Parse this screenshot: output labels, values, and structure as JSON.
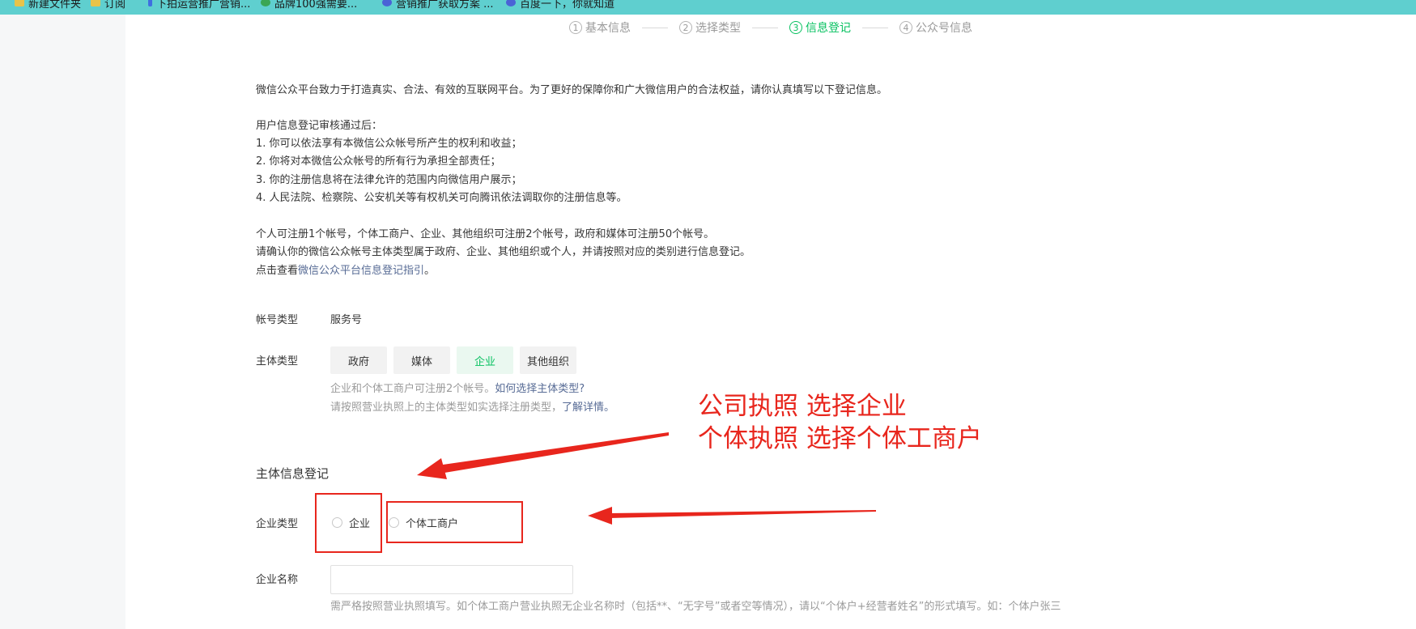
{
  "bookmarks": [
    {
      "label": "新建文件夹",
      "icon": "folder-icon"
    },
    {
      "label": "订阅",
      "icon": "folder-icon"
    },
    {
      "label": "下拍运营推广营销...",
      "icon": "bookmark-icon"
    },
    {
      "label": "品牌100强需要...",
      "icon": "site-icon"
    },
    {
      "label": "营销推广获取方案 ...",
      "icon": "baidu-icon"
    },
    {
      "label": "百度一下，你就知道",
      "icon": "baidu-icon"
    }
  ],
  "steps": [
    {
      "num": "1",
      "label": "基本信息"
    },
    {
      "num": "2",
      "label": "选择类型"
    },
    {
      "num": "3",
      "label": "信息登记"
    },
    {
      "num": "4",
      "label": "公众号信息"
    }
  ],
  "intro": "微信公众平台致力于打造真实、合法、有效的互联网平台。为了更好的保障你和广大微信用户的合法权益，请你认真填写以下登记信息。",
  "after_title": "用户信息登记审核通过后：",
  "after_items": [
    "1. 你可以依法享有本微信公众帐号所产生的权利和收益；",
    "2. 你将对本微信公众帐号的所有行为承担全部责任；",
    "3. 你的注册信息将在法律允许的范围内向微信用户展示；",
    "4. 人民法院、检察院、公安机关等有权机关可向腾讯依法调取你的注册信息等。"
  ],
  "rules": [
    "个人可注册1个帐号，个体工商户、企业、其他组织可注册2个帐号，政府和媒体可注册50个帐号。",
    "请确认你的微信公众帐号主体类型属于政府、企业、其他组织或个人，并请按照对应的类别进行信息登记。"
  ],
  "guide": {
    "prefix": "点击查看",
    "link": "微信公众平台信息登记指引",
    "suffix": "。"
  },
  "account_type": {
    "label": "帐号类型",
    "value": "服务号"
  },
  "subject_type": {
    "label": "主体类型",
    "options": [
      "政府",
      "媒体",
      "企业",
      "其他组织"
    ],
    "selected": "企业",
    "hint1": "企业和个体工商户可注册2个帐号。",
    "hint1_link": "如何选择主体类型?",
    "hint2": "请按照营业执照上的主体类型如实选择注册类型，",
    "hint2_link": "了解详情。"
  },
  "section_title": "主体信息登记",
  "enterprise_type": {
    "label": "企业类型",
    "options": [
      "企业",
      "个体工商户"
    ]
  },
  "enterprise_name": {
    "label": "企业名称",
    "value": "",
    "hint": "需严格按照营业执照填写。如个体工商户营业执照无企业名称时（包括**、“无字号”或者空等情况），请以“个体户+经营者姓名”的形式填写。如：个体户张三"
  },
  "annotation": {
    "line1": "公司执照 选择企业",
    "line2": "个体执照 选择个体工商户"
  },
  "colors": {
    "accent": "#07c160",
    "link": "#576b95",
    "annotation": "#e8261d",
    "bookmark_bar": "#5fcfcf"
  }
}
